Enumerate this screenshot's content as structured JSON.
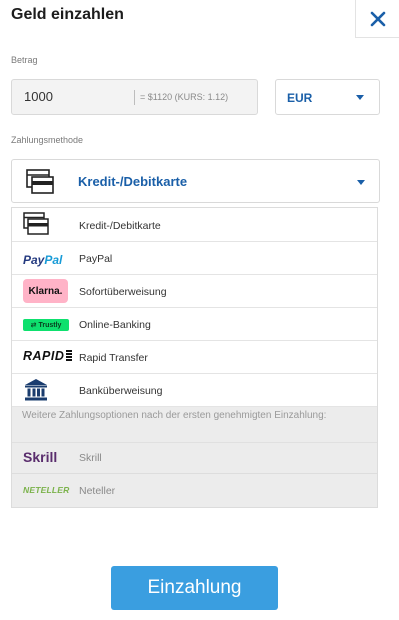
{
  "header": {
    "title": "Geld einzahlen",
    "close_icon": "close-icon"
  },
  "amount": {
    "label": "Betrag",
    "value": "1000",
    "conversion": "= $1120  (KURS: 1.12)"
  },
  "currency": {
    "selected": "EUR"
  },
  "payment_method": {
    "label": "Zahlungsmethode",
    "selected": "Kredit-/Debitkarte",
    "options": [
      {
        "label": "Kredit-/Debitkarte",
        "icon": "credit-card-icon"
      },
      {
        "label": "PayPal",
        "logo_text": "PayPal",
        "icon": "paypal-logo"
      },
      {
        "label": "Sofortüberweisung",
        "logo_text": "Klarna.",
        "icon": "klarna-logo"
      },
      {
        "label": "Online-Banking",
        "logo_text": "Trustly",
        "icon": "trustly-logo"
      },
      {
        "label": "Rapid Transfer",
        "logo_text": "RAPID",
        "icon": "rapid-logo"
      },
      {
        "label": "Banküberweisung",
        "icon": "bank-icon"
      }
    ],
    "info_text": "Weitere Zahlungsoptionen nach der ersten genehmigten Einzahlung:",
    "restricted_options": [
      {
        "label": "Skrill",
        "logo_text": "Skrill",
        "icon": "skrill-logo"
      },
      {
        "label": "Neteller",
        "logo_text": "NETELLER",
        "icon": "neteller-logo"
      }
    ]
  },
  "submit": {
    "label": "Einzahlung"
  },
  "colors": {
    "accent": "#1a5fa8",
    "button": "#3a9ee0",
    "klarna": "#ffb3c7",
    "trustly": "#0ee06e",
    "skrill": "#5a2d6d",
    "neteller": "#7ab24a"
  }
}
